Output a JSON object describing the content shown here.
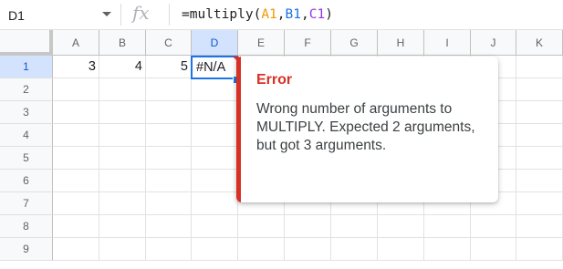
{
  "name_box": "D1",
  "fx_label": "fx",
  "formula": {
    "prefix": "=multiply(",
    "args": [
      {
        "text": "A1",
        "color": "#f29900"
      },
      {
        "text": ",",
        "color": "#202124"
      },
      {
        "text": "B1",
        "color": "#1a73e8"
      },
      {
        "text": ",",
        "color": "#202124"
      },
      {
        "text": "C1",
        "color": "#9334e6"
      }
    ],
    "suffix": ")"
  },
  "columns": [
    "A",
    "B",
    "C",
    "D",
    "E",
    "F",
    "G",
    "H",
    "I",
    "J",
    "K"
  ],
  "rows": [
    "1",
    "2",
    "3",
    "4",
    "5",
    "6",
    "7",
    "8",
    "9"
  ],
  "cells": {
    "A1": "3",
    "B1": "4",
    "C1": "5",
    "D1": "#N/A"
  },
  "error": {
    "title": "Error",
    "message": "Wrong number of arguments to MULTIPLY. Expected 2 arguments, but got 3 arguments."
  },
  "colors": {
    "error_red": "#d93025",
    "selection_blue": "#1a73e8"
  }
}
